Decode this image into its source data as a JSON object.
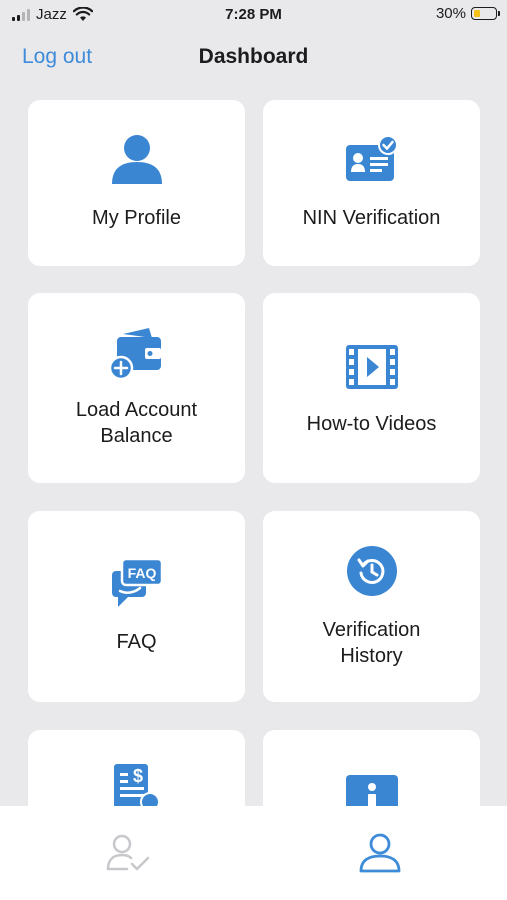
{
  "status_bar": {
    "carrier": "Jazz",
    "time": "7:28 PM",
    "battery_percent": "30%",
    "battery_level": 0.3
  },
  "nav": {
    "logout_label": "Log out",
    "title": "Dashboard"
  },
  "cards": [
    {
      "label": "My Profile",
      "icon": "profile-icon"
    },
    {
      "label": "NIN Verification",
      "icon": "id-card-check-icon"
    },
    {
      "label": "Load Account Balance",
      "icon": "wallet-add-icon"
    },
    {
      "label": "How-to Videos",
      "icon": "video-film-icon"
    },
    {
      "label": "FAQ",
      "icon": "faq-icon"
    },
    {
      "label": "Verification History",
      "icon": "history-icon"
    },
    {
      "label": "",
      "icon": "receipt-icon"
    },
    {
      "label": "",
      "icon": "info-icon"
    }
  ],
  "tab_bar": {
    "tabs": [
      {
        "name": "verified-user-tab",
        "icon": "user-check-icon",
        "active": false
      },
      {
        "name": "profile-tab",
        "icon": "user-icon",
        "active": true
      }
    ]
  },
  "colors": {
    "accent": "#3d8bd9",
    "icon_blue": "#3b86d3",
    "background": "#e9e9ec",
    "card": "#ffffff",
    "inactive_tab": "#c7c7cc"
  }
}
